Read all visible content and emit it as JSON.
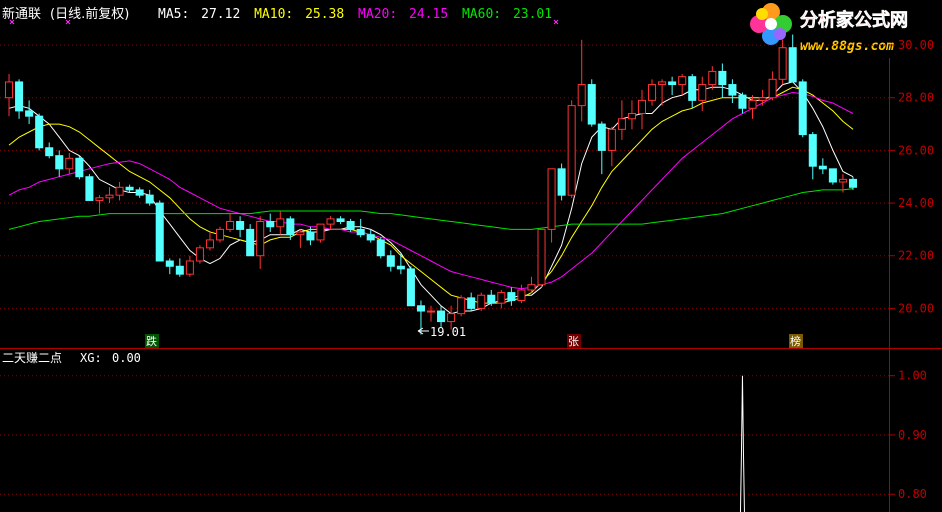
{
  "header": {
    "stock_name": "新通联",
    "period": "(日线.前复权)",
    "ma_items": [
      {
        "label": "MA5:",
        "value": "27.12",
        "color": "#ffffff"
      },
      {
        "label": "MA10:",
        "value": "25.38",
        "color": "#ffff00"
      },
      {
        "label": "MA20:",
        "value": "24.15",
        "color": "#ff00ff"
      },
      {
        "label": "MA60:",
        "value": "23.01",
        "color": "#00e400"
      }
    ]
  },
  "logo": {
    "title": "分析家公式网",
    "url": "www.88gs.com"
  },
  "indicator": {
    "name": "二天赚二点",
    "xg_label": "XG:",
    "xg_value": "0.00"
  },
  "markers": {
    "low_label": "19.01",
    "tag_fall": "跌",
    "tag_rise": "张",
    "tag_list": "榜"
  },
  "colors": {
    "up": "#ff3333",
    "down": "#54ffff",
    "grid": "#8b0000",
    "axis": "#b00000"
  },
  "chart_data": [
    {
      "type": "candlestick",
      "title": "新通联(日线.前复权)",
      "ylim": [
        18.8,
        30.8
      ],
      "y_ticks": [
        "30.00",
        "28.00",
        "26.00",
        "24.00",
        "22.00",
        "20.00"
      ],
      "series": [
        {
          "name": "MA5",
          "value": 27.12,
          "color": "#ffffff"
        },
        {
          "name": "MA10",
          "value": 25.38,
          "color": "#ffff00"
        },
        {
          "name": "MA20",
          "value": 24.15,
          "color": "#ff00ff"
        },
        {
          "name": "MA60",
          "value": 23.01,
          "color": "#00e400"
        }
      ],
      "ohlc": [
        [
          28.0,
          28.9,
          27.3,
          28.6
        ],
        [
          28.6,
          28.7,
          27.2,
          27.5
        ],
        [
          27.5,
          27.9,
          27.0,
          27.3
        ],
        [
          27.3,
          27.4,
          26.0,
          26.1
        ],
        [
          26.1,
          26.3,
          25.7,
          25.8
        ],
        [
          25.8,
          26.0,
          25.0,
          25.3
        ],
        [
          25.3,
          25.9,
          25.1,
          25.7
        ],
        [
          25.7,
          25.8,
          24.9,
          25.0
        ],
        [
          25.0,
          25.1,
          24.1,
          24.1
        ],
        [
          24.1,
          24.3,
          23.6,
          24.2
        ],
        [
          24.2,
          24.6,
          24.0,
          24.3
        ],
        [
          24.3,
          24.8,
          24.1,
          24.6
        ],
        [
          24.6,
          24.7,
          24.4,
          24.5
        ],
        [
          24.5,
          24.6,
          24.2,
          24.3
        ],
        [
          24.3,
          24.5,
          23.9,
          24.0
        ],
        [
          24.0,
          24.1,
          21.8,
          21.8
        ],
        [
          21.8,
          21.9,
          21.3,
          21.6
        ],
        [
          21.6,
          21.9,
          21.2,
          21.3
        ],
        [
          21.3,
          22.0,
          21.2,
          21.8
        ],
        [
          21.8,
          22.4,
          21.7,
          22.3
        ],
        [
          22.3,
          22.9,
          22.2,
          22.6
        ],
        [
          22.6,
          23.1,
          22.5,
          23.0
        ],
        [
          23.0,
          23.6,
          22.9,
          23.3
        ],
        [
          23.3,
          23.5,
          22.7,
          23.0
        ],
        [
          23.0,
          23.2,
          22.0,
          22.0
        ],
        [
          22.0,
          23.5,
          21.5,
          23.3
        ],
        [
          23.3,
          23.6,
          22.9,
          23.1
        ],
        [
          23.1,
          23.7,
          22.8,
          23.4
        ],
        [
          23.4,
          23.5,
          22.6,
          22.8
        ],
        [
          22.8,
          23.0,
          22.3,
          22.9
        ],
        [
          22.9,
          23.1,
          22.4,
          22.6
        ],
        [
          22.6,
          23.2,
          22.5,
          23.2
        ],
        [
          23.2,
          23.5,
          23.0,
          23.4
        ],
        [
          23.4,
          23.5,
          23.2,
          23.3
        ],
        [
          23.3,
          23.4,
          22.9,
          23.0
        ],
        [
          23.0,
          23.4,
          22.7,
          22.8
        ],
        [
          22.8,
          23.0,
          22.5,
          22.6
        ],
        [
          22.6,
          22.7,
          21.9,
          22.0
        ],
        [
          22.0,
          22.2,
          21.4,
          21.6
        ],
        [
          21.6,
          22.1,
          21.3,
          21.5
        ],
        [
          21.5,
          21.6,
          20.1,
          20.1
        ],
        [
          20.1,
          20.3,
          19.01,
          19.9
        ],
        [
          19.9,
          20.1,
          19.5,
          19.9
        ],
        [
          19.9,
          20.1,
          19.3,
          19.5
        ],
        [
          19.5,
          20.1,
          19.2,
          19.8
        ],
        [
          19.8,
          20.5,
          19.7,
          20.4
        ],
        [
          20.4,
          20.6,
          19.9,
          20.0
        ],
        [
          20.0,
          20.6,
          19.9,
          20.5
        ],
        [
          20.5,
          20.7,
          20.1,
          20.2
        ],
        [
          20.2,
          20.7,
          20.0,
          20.6
        ],
        [
          20.6,
          20.8,
          20.1,
          20.3
        ],
        [
          20.3,
          20.9,
          20.2,
          20.7
        ],
        [
          20.7,
          21.2,
          20.6,
          20.9
        ],
        [
          20.9,
          23.0,
          20.8,
          23.0
        ],
        [
          23.0,
          25.3,
          22.5,
          25.3
        ],
        [
          25.3,
          25.5,
          24.1,
          24.3
        ],
        [
          24.3,
          27.9,
          24.2,
          27.7
        ],
        [
          27.7,
          30.2,
          27.1,
          28.5
        ],
        [
          28.5,
          28.7,
          26.9,
          27.0
        ],
        [
          27.0,
          27.1,
          25.1,
          26.0
        ],
        [
          26.0,
          26.9,
          25.4,
          26.8
        ],
        [
          26.8,
          27.9,
          26.4,
          27.2
        ],
        [
          27.2,
          27.9,
          26.8,
          27.4
        ],
        [
          27.4,
          28.3,
          26.8,
          27.9
        ],
        [
          27.9,
          28.7,
          27.7,
          28.5
        ],
        [
          28.5,
          28.7,
          27.7,
          28.6
        ],
        [
          28.6,
          28.8,
          28.1,
          28.5
        ],
        [
          28.5,
          28.9,
          28.1,
          28.8
        ],
        [
          28.8,
          28.9,
          27.6,
          27.9
        ],
        [
          27.9,
          28.8,
          27.5,
          28.5
        ],
        [
          28.5,
          29.2,
          28.3,
          29.0
        ],
        [
          29.0,
          29.3,
          28.0,
          28.5
        ],
        [
          28.5,
          28.7,
          27.8,
          28.1
        ],
        [
          28.1,
          28.2,
          27.4,
          27.6
        ],
        [
          27.6,
          28.1,
          27.2,
          27.9
        ],
        [
          27.9,
          28.3,
          27.7,
          28.0
        ],
        [
          28.0,
          29.0,
          27.9,
          28.7
        ],
        [
          28.7,
          30.2,
          28.5,
          29.9
        ],
        [
          29.9,
          30.4,
          28.6,
          28.6
        ],
        [
          28.6,
          28.7,
          26.5,
          26.6
        ],
        [
          26.6,
          26.7,
          24.9,
          25.4
        ],
        [
          25.4,
          25.7,
          25.1,
          25.3
        ],
        [
          25.3,
          25.3,
          24.7,
          24.8
        ],
        [
          24.8,
          25.1,
          24.4,
          24.9
        ],
        [
          24.9,
          25.0,
          24.5,
          24.6
        ]
      ],
      "ma": {
        "MA5": [
          27.6,
          27.7,
          27.6,
          27.3,
          27.0,
          26.5,
          26.0,
          25.8,
          25.4,
          24.9,
          24.7,
          24.5,
          24.4,
          24.4,
          24.3,
          23.7,
          23.2,
          22.7,
          22.2,
          21.9,
          21.7,
          21.9,
          22.4,
          22.6,
          22.5,
          22.6,
          22.8,
          22.8,
          22.8,
          23.0,
          22.9,
          22.9,
          23.0,
          23.0,
          23.1,
          23.1,
          23.0,
          22.8,
          22.5,
          22.1,
          21.5,
          20.9,
          20.5,
          20.1,
          19.8,
          19.9,
          19.9,
          20.0,
          20.2,
          20.3,
          20.4,
          20.5,
          20.5,
          20.8,
          21.6,
          22.4,
          23.8,
          25.5,
          26.5,
          26.9,
          26.8,
          27.2,
          27.3,
          27.4,
          27.4,
          27.8,
          28.0,
          28.1,
          28.3,
          28.3,
          28.4,
          28.4,
          28.3,
          28.1,
          27.9,
          27.9,
          28.1,
          28.5,
          28.6,
          28.2,
          27.6,
          26.9,
          26.0,
          25.2,
          25.0
        ],
        "MA10": [
          26.2,
          26.5,
          26.7,
          26.9,
          27.0,
          27.0,
          26.9,
          26.7,
          26.4,
          26.1,
          25.8,
          25.5,
          25.2,
          25.0,
          24.8,
          24.5,
          24.2,
          23.8,
          23.4,
          23.1,
          22.9,
          22.8,
          22.7,
          22.6,
          22.5,
          22.4,
          22.6,
          22.7,
          22.7,
          22.9,
          23.0,
          23.0,
          23.0,
          23.0,
          23.0,
          22.9,
          22.8,
          22.6,
          22.4,
          22.0,
          21.7,
          21.4,
          21.1,
          20.8,
          20.5,
          20.4,
          20.3,
          20.2,
          20.2,
          20.2,
          20.3,
          20.4,
          20.6,
          21.0,
          21.4,
          22.0,
          22.7,
          23.3,
          23.9,
          24.6,
          25.2,
          25.6,
          26.0,
          26.4,
          26.8,
          27.1,
          27.3,
          27.5,
          27.6,
          27.8,
          27.9,
          28.0,
          28.0,
          28.0,
          28.0,
          28.0,
          28.0,
          28.2,
          28.4,
          28.3,
          28.1,
          27.8,
          27.5,
          27.1,
          26.8
        ],
        "MA20": [
          24.3,
          24.5,
          24.6,
          24.8,
          24.9,
          25.0,
          25.1,
          25.2,
          25.3,
          25.4,
          25.5,
          25.55,
          25.6,
          25.5,
          25.3,
          25.1,
          24.9,
          24.6,
          24.4,
          24.2,
          24.0,
          23.8,
          23.7,
          23.6,
          23.5,
          23.4,
          23.3,
          23.3,
          23.2,
          23.2,
          23.1,
          23.1,
          23.0,
          23.0,
          22.9,
          22.9,
          22.8,
          22.7,
          22.6,
          22.4,
          22.2,
          22.0,
          21.8,
          21.6,
          21.4,
          21.3,
          21.2,
          21.1,
          21.0,
          20.9,
          20.8,
          20.75,
          20.8,
          20.9,
          21.0,
          21.2,
          21.5,
          21.8,
          22.1,
          22.5,
          22.9,
          23.3,
          23.7,
          24.1,
          24.5,
          24.9,
          25.3,
          25.7,
          26.0,
          26.3,
          26.6,
          26.9,
          27.2,
          27.4,
          27.6,
          27.8,
          28.0,
          28.1,
          28.2,
          28.15,
          28.05,
          27.9,
          27.8,
          27.6,
          27.4
        ],
        "MA60": [
          23.0,
          23.1,
          23.2,
          23.3,
          23.35,
          23.4,
          23.45,
          23.5,
          23.5,
          23.55,
          23.6,
          23.6,
          23.6,
          23.6,
          23.6,
          23.6,
          23.6,
          23.6,
          23.6,
          23.6,
          23.6,
          23.6,
          23.6,
          23.6,
          23.6,
          23.65,
          23.7,
          23.7,
          23.7,
          23.7,
          23.7,
          23.7,
          23.7,
          23.7,
          23.7,
          23.7,
          23.65,
          23.6,
          23.6,
          23.55,
          23.5,
          23.45,
          23.4,
          23.35,
          23.3,
          23.25,
          23.2,
          23.15,
          23.1,
          23.05,
          23.0,
          23.0,
          23.0,
          23.05,
          23.1,
          23.15,
          23.2,
          23.2,
          23.2,
          23.2,
          23.2,
          23.2,
          23.2,
          23.2,
          23.25,
          23.3,
          23.35,
          23.4,
          23.45,
          23.5,
          23.55,
          23.6,
          23.7,
          23.8,
          23.9,
          24.0,
          24.1,
          24.2,
          24.3,
          24.4,
          24.45,
          24.5,
          24.5,
          24.5,
          24.55
        ]
      }
    },
    {
      "type": "line",
      "title": "二天赚二点",
      "series": [
        {
          "name": "XG",
          "values_note": "",
          "spike_index": 73
        }
      ],
      "ylim": [
        0.77,
        1.04
      ],
      "y_ticks": [
        "1.00",
        "0.90",
        "0.80"
      ],
      "spike_value": 1.0
    }
  ]
}
